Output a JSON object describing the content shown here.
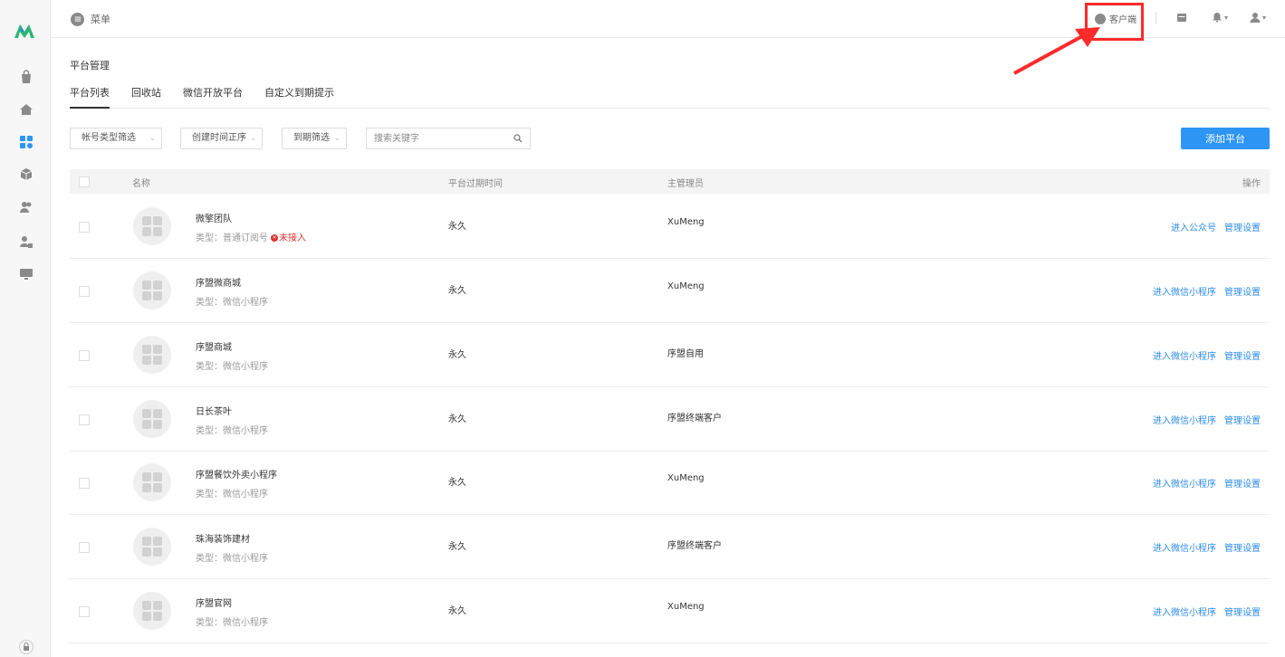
{
  "topbar": {
    "menu_label": "菜单",
    "client_label": "客户端"
  },
  "page": {
    "title": "平台管理",
    "tabs": [
      {
        "label": "平台列表",
        "active": true
      },
      {
        "label": "回收站",
        "active": false
      },
      {
        "label": "微信开放平台",
        "active": false
      },
      {
        "label": "自定义到期提示",
        "active": false
      }
    ]
  },
  "filters": {
    "account_type": "帐号类型筛选",
    "create_time": "创建时间正序",
    "expire": "到期筛选",
    "search_placeholder": "搜索关键字",
    "add_button": "添加平台"
  },
  "table": {
    "headers": {
      "name": "名称",
      "expire": "平台过期时间",
      "admin": "主管理员",
      "ops": "操作"
    },
    "rows": [
      {
        "name": "微擎团队",
        "type": "类型：普通订阅号",
        "status": "未接入",
        "expire": "永久",
        "admin": "XuMeng",
        "op1": "进入公众号",
        "op2": "管理设置"
      },
      {
        "name": "序盟微商城",
        "type": "类型：微信小程序",
        "status": "",
        "expire": "永久",
        "admin": "XuMeng",
        "op1": "进入微信小程序",
        "op2": "管理设置"
      },
      {
        "name": "序盟商城",
        "type": "类型：微信小程序",
        "status": "",
        "expire": "永久",
        "admin": "序盟自用",
        "op1": "进入微信小程序",
        "op2": "管理设置"
      },
      {
        "name": "日长茶叶",
        "type": "类型：微信小程序",
        "status": "",
        "expire": "永久",
        "admin": "序盟终端客户",
        "op1": "进入微信小程序",
        "op2": "管理设置"
      },
      {
        "name": "序盟餐饮外卖小程序",
        "type": "类型：微信小程序",
        "status": "",
        "expire": "永久",
        "admin": "XuMeng",
        "op1": "进入微信小程序",
        "op2": "管理设置"
      },
      {
        "name": "珠海装饰建材",
        "type": "类型：微信小程序",
        "status": "",
        "expire": "永久",
        "admin": "序盟终端客户",
        "op1": "进入微信小程序",
        "op2": "管理设置"
      },
      {
        "name": "序盟官网",
        "type": "类型：微信小程序",
        "status": "",
        "expire": "永久",
        "admin": "XuMeng",
        "op1": "进入微信小程序",
        "op2": "管理设置"
      }
    ]
  },
  "colors": {
    "accent": "#2d95f3",
    "link": "#2d8ce8",
    "warn": "#e0302f",
    "highlight": "#ff2a2a"
  }
}
